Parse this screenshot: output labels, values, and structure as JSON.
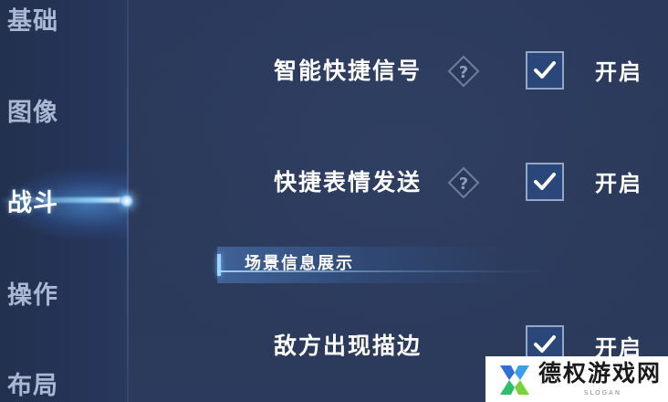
{
  "sidebar": {
    "items": [
      {
        "label": "基础",
        "active": false
      },
      {
        "label": "图像",
        "active": false
      },
      {
        "label": "战斗",
        "active": true
      },
      {
        "label": "操作",
        "active": false
      },
      {
        "label": "布局",
        "active": false
      }
    ]
  },
  "settings": [
    {
      "label": "智能快捷信号",
      "has_help": true,
      "help_icon": "question-diamond-icon",
      "checked": true,
      "checkbox_text": "开启"
    },
    {
      "label": "快捷表情发送",
      "has_help": true,
      "help_icon": "question-diamond-icon",
      "checked": true,
      "checkbox_text": "开启"
    },
    {
      "label": "敌方出现描边",
      "has_help": false,
      "checked": true,
      "checkbox_text": "开启"
    }
  ],
  "section": {
    "title": "场景信息展示"
  },
  "watermark": {
    "logo_icon": "x-shield-logo",
    "text": "德权游戏网",
    "sub": "SLOGAN"
  },
  "colors": {
    "background": "#2a3858",
    "accent": "#9fd3ff",
    "checkbox_fill": "#2b4678",
    "checkbox_border": "#93a7c9",
    "inactive_text": "#a9b7d3"
  }
}
